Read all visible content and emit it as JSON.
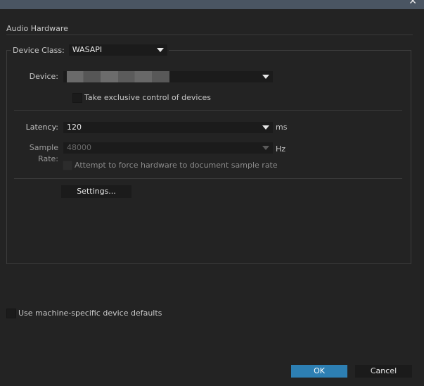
{
  "window": {
    "close_icon": "close-icon"
  },
  "section": {
    "title": "Audio Hardware"
  },
  "device_class": {
    "label": "Device Class:",
    "value": "WASAPI"
  },
  "device": {
    "label": "Device:",
    "value": ""
  },
  "exclusive": {
    "label": "Take exclusive control of devices",
    "checked": false
  },
  "latency": {
    "label": "Latency:",
    "value": "120",
    "unit": "ms"
  },
  "sample_rate": {
    "label": "Sample Rate:",
    "value": "48000",
    "unit": "Hz",
    "enabled": false
  },
  "force_rate": {
    "label": "Attempt to force hardware to document sample rate",
    "checked": false,
    "enabled": false
  },
  "settings_button": {
    "label": "Settings..."
  },
  "machine_defaults": {
    "label": "Use machine-specific device defaults",
    "checked": false
  },
  "footer": {
    "ok_label": "OK",
    "cancel_label": "Cancel"
  },
  "colors": {
    "accent": "#2d7fb3",
    "background": "#232323",
    "titlebar": "#4a5562"
  }
}
